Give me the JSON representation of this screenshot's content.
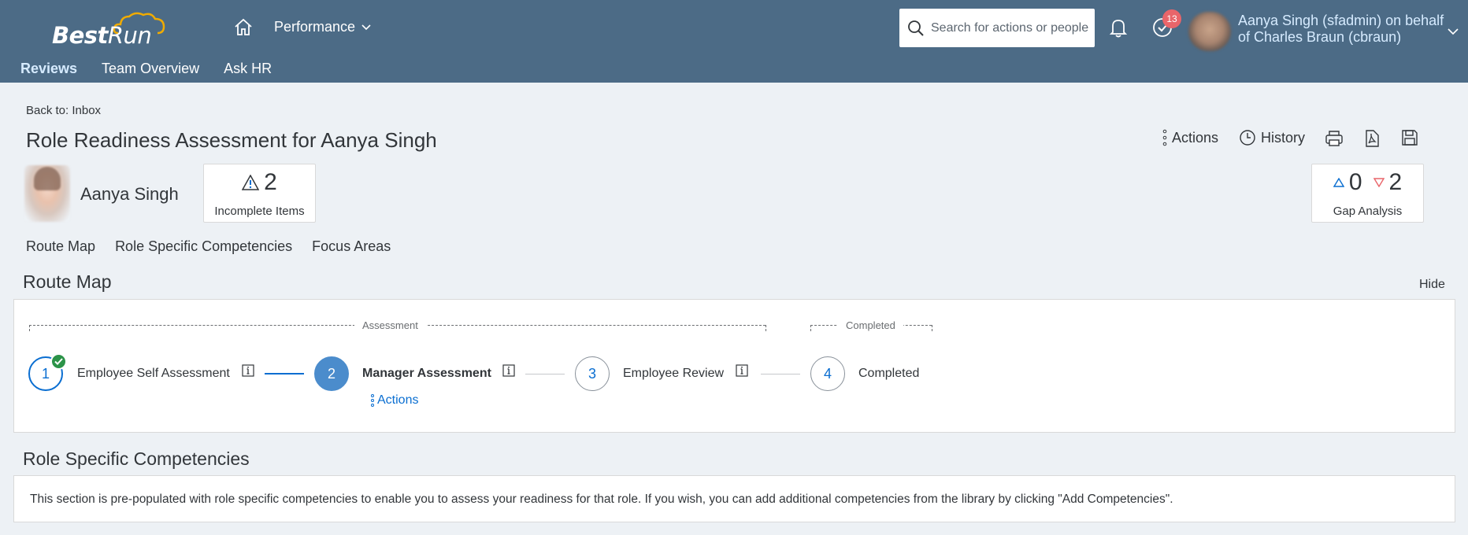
{
  "header": {
    "logo_text_a": "Best",
    "logo_text_b": "Run",
    "module_menu": "Performance",
    "tabs": [
      {
        "label": "Reviews"
      },
      {
        "label": "Team Overview"
      },
      {
        "label": "Ask HR"
      }
    ],
    "search_placeholder": "Search for actions or people",
    "notification_badge": "13",
    "user_text": "Aanya Singh (sfadmin) on behalf of Charles Braun (cbraun)"
  },
  "page": {
    "back_link": "Back to: Inbox",
    "title": "Role Readiness Assessment for Aanya Singh",
    "toolbar": {
      "actions_label": "Actions",
      "history_label": "History"
    },
    "employee_name": "Aanya Singh",
    "incomplete": {
      "value": "2",
      "label": "Incomplete Items"
    },
    "gap": {
      "up_value": "0",
      "down_value": "2",
      "label": "Gap Analysis"
    },
    "section_links": [
      "Route Map",
      "Role Specific Competencies",
      "Focus Areas"
    ]
  },
  "route_map": {
    "title": "Route Map",
    "hide_label": "Hide",
    "groups": {
      "assessment": "Assessment",
      "completed": "Completed"
    },
    "steps": [
      {
        "number": "1",
        "label": "Employee Self Assessment",
        "state": "done"
      },
      {
        "number": "2",
        "label": "Manager Assessment",
        "state": "current"
      },
      {
        "number": "3",
        "label": "Employee Review",
        "state": "pending"
      },
      {
        "number": "4",
        "label": "Completed",
        "state": "pending"
      }
    ],
    "step_actions_label": "Actions"
  },
  "competencies": {
    "title": "Role Specific Competencies",
    "description": "This section is pre-populated with role specific competencies to enable you to assess your readiness for that role.  If you wish, you can add additional competencies from the library by clicking \"Add Competencies\"."
  },
  "colors": {
    "shell": "#4c6b86",
    "accent": "#0a6ed1",
    "current_step": "#4b8ccc",
    "check": "#2b9348",
    "badge": "#e9656a",
    "gap_down": "#e9656a"
  }
}
